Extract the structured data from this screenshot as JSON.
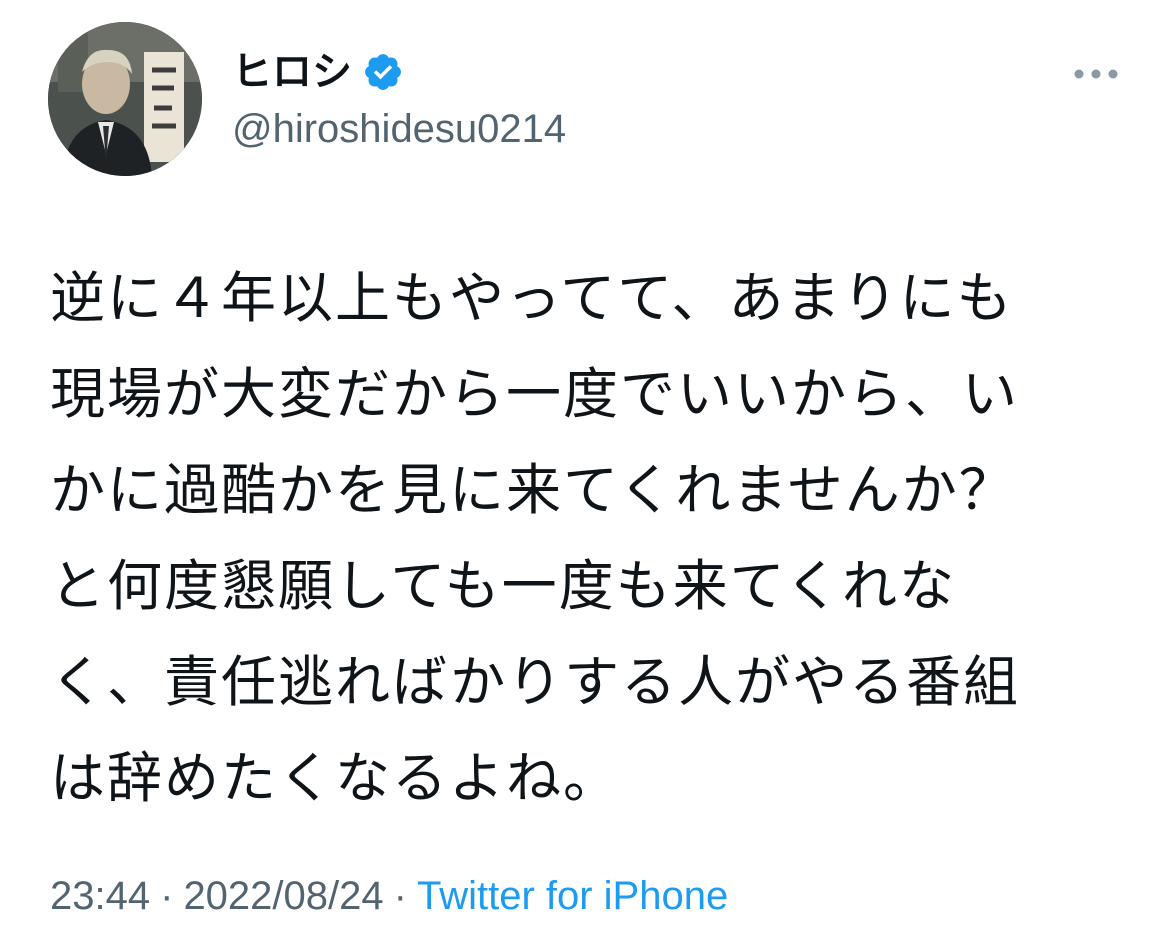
{
  "author": {
    "display_name": "ヒロシ",
    "handle": "@hiroshidesu0214",
    "verified": true,
    "avatar_icon": "user-avatar"
  },
  "tweet": {
    "lines": [
      "逆に４年以上もやってて、あまりにも",
      "現場が大変だから一度でいいから、い",
      "かに過酷かを見に来てくれませんか？",
      "と何度懇願しても一度も来てくれな",
      "く、責任逃ればかりする人がやる番組",
      "は辞めたくなるよね。"
    ],
    "time": "23:44",
    "date": "2022/08/24",
    "separator": "·",
    "source": "Twitter for iPhone"
  },
  "menu": {
    "more_icon": "more-horizontal-icon"
  },
  "colors": {
    "text_primary": "#0f1419",
    "text_secondary": "#536471",
    "accent": "#1d9bf0"
  }
}
